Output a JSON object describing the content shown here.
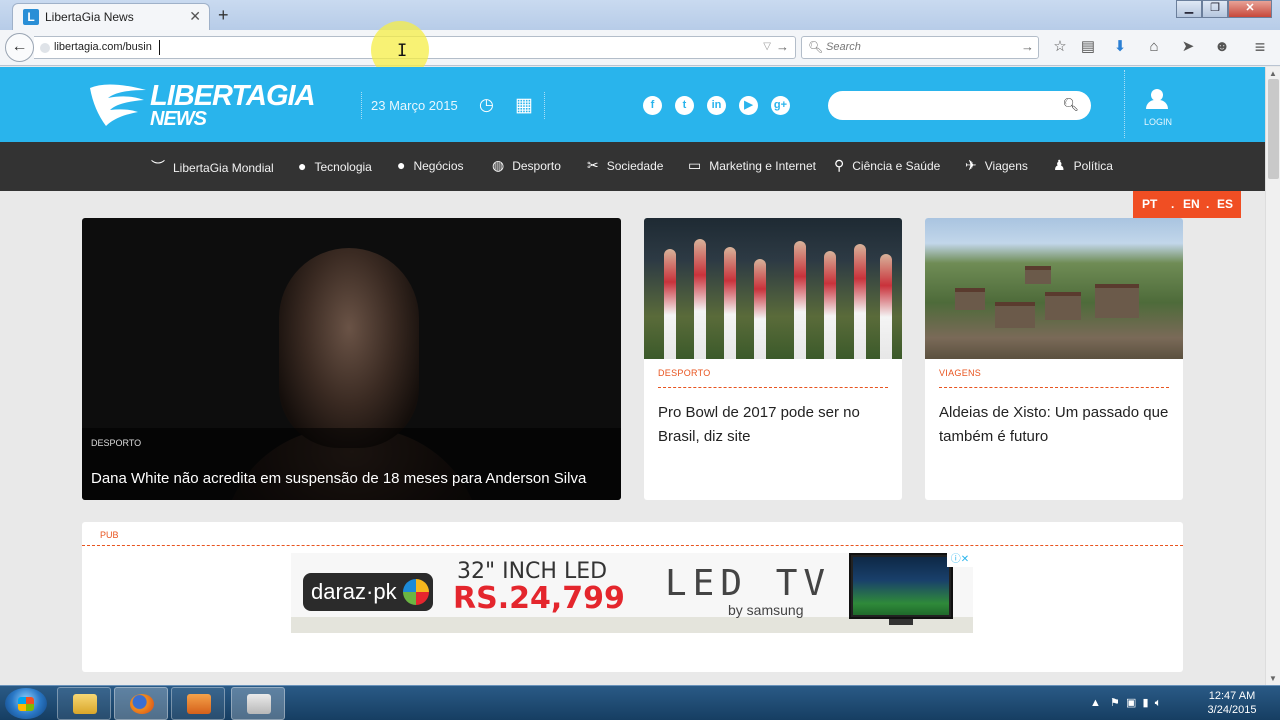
{
  "browser": {
    "tab_title": "LibertaGia News",
    "tab_favicon": "L",
    "url": "libertagia.com/busin",
    "search_placeholder": "Search",
    "icons": [
      "back-icon",
      "star-icon",
      "reading-list-icon",
      "download-icon",
      "home-icon",
      "share-icon",
      "chat-icon",
      "menu-icon"
    ]
  },
  "header": {
    "logo_main": "LIBERTAGIA",
    "logo_sub": "NEWS",
    "date": "23 Março 2015",
    "login_label": "LOGIN",
    "social": [
      "f",
      "t",
      "in",
      "▶",
      "g+"
    ]
  },
  "nav": {
    "items": [
      {
        "label": "LibertaGia Mondial",
        "icon": "mask-icon"
      },
      {
        "label": "Tecnologia",
        "icon": "bulb-icon"
      },
      {
        "label": "Negócios",
        "icon": "moneybag-icon"
      },
      {
        "label": "Desporto",
        "icon": "ball-icon"
      },
      {
        "label": "Sociedade",
        "icon": "scissors-icon"
      },
      {
        "label": "Marketing e Internet",
        "icon": "monitor-icon"
      },
      {
        "label": "Ciência e Saúde",
        "icon": "flask-icon"
      },
      {
        "label": "Viagens",
        "icon": "plane-icon"
      },
      {
        "label": "Política",
        "icon": "person-icon"
      }
    ]
  },
  "lang": {
    "pt": "PT",
    "en": "EN",
    "es": "ES",
    "sep": "."
  },
  "feature": {
    "category": "DESPORTO",
    "title": "Dana White não acredita em suspensão de 18 meses para Anderson Silva"
  },
  "cards": [
    {
      "category": "DESPORTO",
      "title": "Pro Bowl de 2017 pode ser no Brasil, diz site"
    },
    {
      "category": "VIAGENS",
      "title": "Aldeias de Xisto: Um passado que também é futuro"
    }
  ],
  "pub": {
    "label": "PUB",
    "ad_brand": "daraz·pk",
    "ad_headline": "32\" INCH LED",
    "ad_price": "RS.24,799",
    "ad_product": "LED TV",
    "ad_by": "by samsung",
    "ad_choices": "ⓘ✕"
  },
  "taskbar": {
    "time": "12:47 AM",
    "date": "3/24/2015"
  },
  "colors": {
    "header_blue": "#29b4ec",
    "nav_dark": "#333333",
    "accent_orange": "#e8541f",
    "lang_orange": "#f04e23"
  }
}
